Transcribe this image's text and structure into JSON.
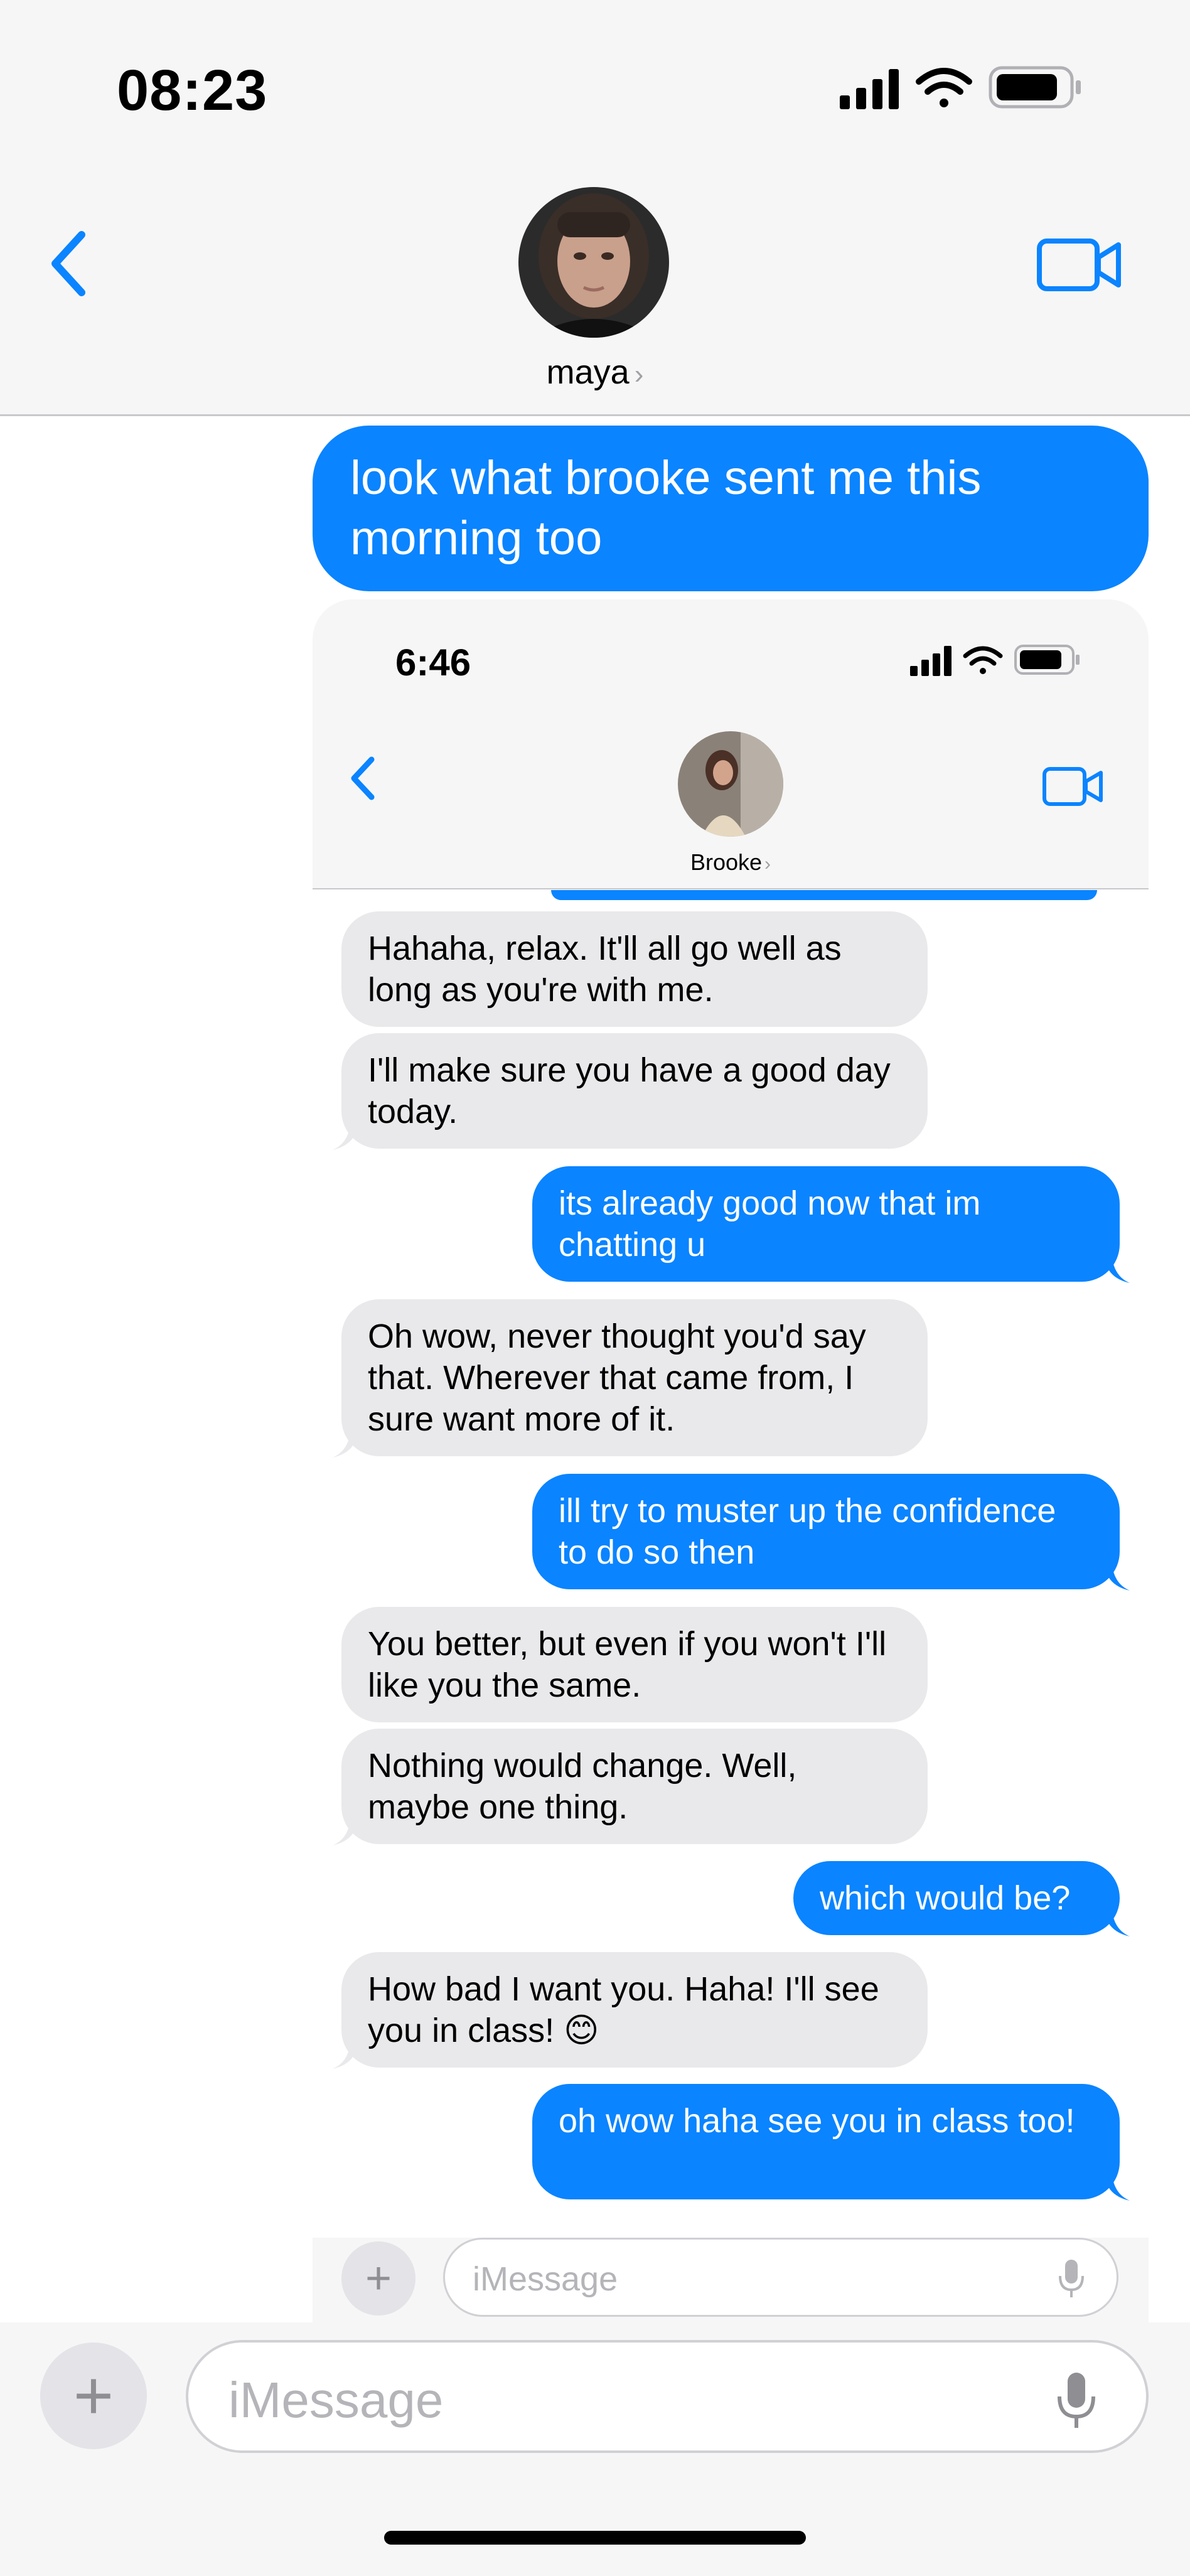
{
  "status_bar": {
    "time": "08:23",
    "icons": [
      "signal-icon",
      "wifi-icon",
      "battery-icon"
    ]
  },
  "header": {
    "contact_name": "maya",
    "chevron": "›"
  },
  "outer_message": {
    "text": "look what brooke sent me this morning too"
  },
  "screenshot": {
    "status_bar": {
      "time": "6:46"
    },
    "header": {
      "contact_name": "Brooke",
      "chevron": "›"
    },
    "messages": [
      {
        "from": "them",
        "text": "Hahaha, relax. It'll all go well as long as you're with me."
      },
      {
        "from": "them",
        "text": "I'll make sure you have a good day today."
      },
      {
        "from": "me",
        "text": "its already good now that im chatting u"
      },
      {
        "from": "them",
        "text": "Oh wow, never thought you'd say that. Wherever that came from, I sure want more of it."
      },
      {
        "from": "me",
        "text": "ill try to muster up the confidence to do so then"
      },
      {
        "from": "them",
        "text": "You better, but even if you won't I'll like you the same."
      },
      {
        "from": "them",
        "text": "Nothing would change. Well, maybe one thing."
      },
      {
        "from": "me",
        "text": "which would be?"
      },
      {
        "from": "them",
        "text": "How bad I want you. Haha! I'll see you in class! 😊"
      },
      {
        "from": "me",
        "text": "oh wow haha see you in class too!"
      }
    ],
    "composer": {
      "placeholder": "iMessage",
      "plus": "+"
    }
  },
  "composer": {
    "placeholder": "iMessage",
    "plus": "+"
  },
  "colors": {
    "accent": "#0a84ff",
    "received_bubble": "#e9e9eb",
    "header_bg": "#f6f6f6"
  }
}
